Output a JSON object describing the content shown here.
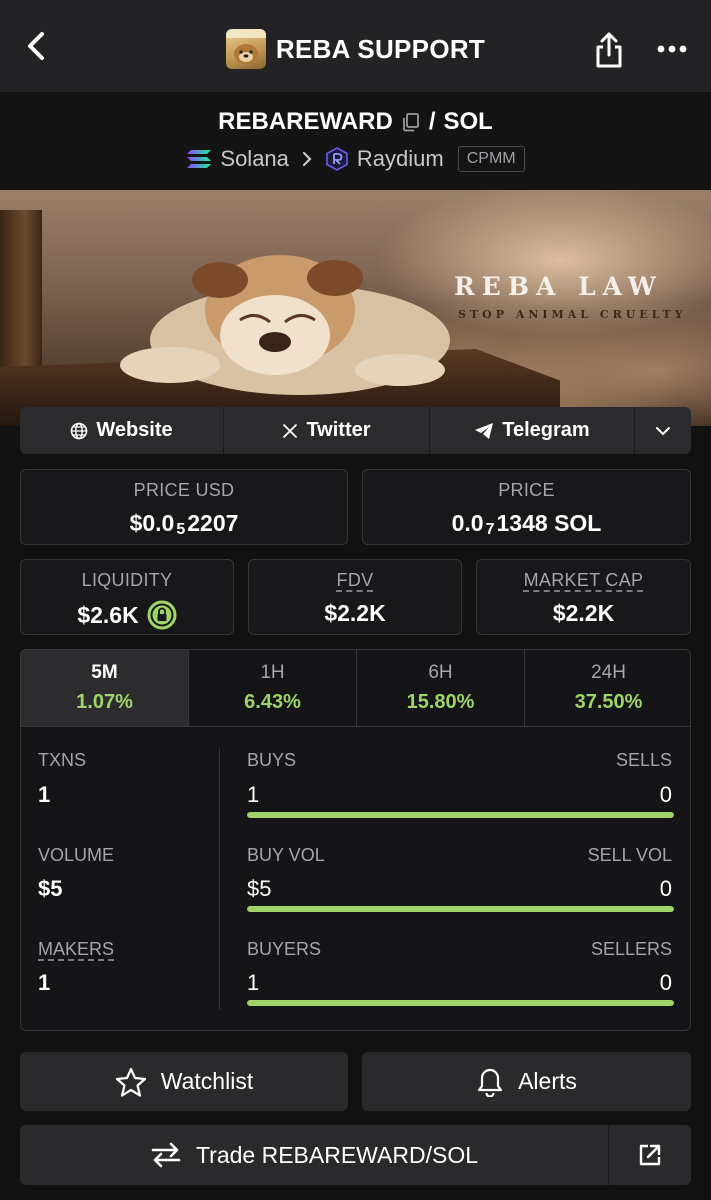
{
  "header": {
    "title": "REBA SUPPORT",
    "avatar_text": "REBA SUPPORT"
  },
  "pair": {
    "base": "REBAREWARD",
    "separator": "/",
    "quote": "SOL",
    "chain": "Solana",
    "dex": "Raydium",
    "pool_type": "CPMM"
  },
  "banner": {
    "title": "REBA LAW",
    "subtitle": "STOP ANIMAL CRUELTY"
  },
  "links": {
    "website": "Website",
    "twitter": "Twitter",
    "telegram": "Telegram"
  },
  "prices": {
    "usd_label": "PRICE USD",
    "usd_prefix": "$0.0",
    "usd_sub": "5",
    "usd_digits": "2207",
    "native_label": "PRICE",
    "native_prefix": "0.0",
    "native_sub": "7",
    "native_digits": "1348 SOL"
  },
  "metrics": {
    "liquidity_label": "LIQUIDITY",
    "liquidity_value": "$2.6K",
    "fdv_label": "FDV",
    "fdv_value": "$2.2K",
    "mcap_label": "MARKET CAP",
    "mcap_value": "$2.2K"
  },
  "timeframes": [
    {
      "label": "5M",
      "change": "1.07%"
    },
    {
      "label": "1H",
      "change": "6.43%"
    },
    {
      "label": "6H",
      "change": "15.80%"
    },
    {
      "label": "24H",
      "change": "37.50%"
    }
  ],
  "stats": {
    "txns_label": "TXNS",
    "txns_value": "1",
    "volume_label": "VOLUME",
    "volume_value": "$5",
    "makers_label": "MAKERS",
    "makers_value": "1",
    "buys_label": "BUYS",
    "buys_value": "1",
    "sells_label": "SELLS",
    "sells_value": "0",
    "buy_vol_label": "BUY VOL",
    "buy_vol_value": "$5",
    "sell_vol_label": "SELL VOL",
    "sell_vol_value": "0",
    "buyers_label": "BUYERS",
    "buyers_value": "1",
    "sellers_label": "SELLERS",
    "sellers_value": "0",
    "buy_share": 1.0,
    "buy_vol_share": 1.0,
    "buyers_share": 1.0
  },
  "actions": {
    "watchlist": "Watchlist",
    "alerts": "Alerts",
    "trade": "Trade REBAREWARD/SOL"
  },
  "colors": {
    "positive": "#9ed468",
    "background": "#111112",
    "card": "#18181a"
  }
}
